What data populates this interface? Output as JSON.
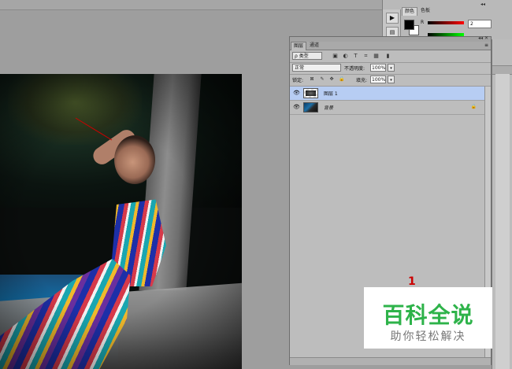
{
  "color_panel": {
    "tabs": [
      "颜色",
      "色板"
    ],
    "channel_r_label": "R",
    "channel_r_value": "2",
    "foreground_color": "#000000",
    "background_color": "#ffffff"
  },
  "layers_panel": {
    "tabs": [
      "图层",
      "通道"
    ],
    "filter_kind": "ρ 类型",
    "blend_mode": "正常",
    "opacity_label": "不透明度:",
    "opacity_value": "100%",
    "lock_label": "锁定:",
    "fill_label": "填充:",
    "fill_value": "100%",
    "layers": [
      {
        "name": "图层 1",
        "selected": true,
        "visible": true,
        "locked": false
      },
      {
        "name": "背景",
        "selected": false,
        "visible": true,
        "locked": true
      }
    ]
  },
  "annotation": {
    "marker": "1",
    "color": "#cc0000"
  },
  "watermark": {
    "title": "百科全说",
    "subtitle": "助你轻松解决",
    "title_color": "#2eb34a"
  },
  "icons": {
    "play": "play-icon",
    "eye": "eye-icon",
    "lock": "lock-icon",
    "menu": "panel-menu-icon"
  }
}
